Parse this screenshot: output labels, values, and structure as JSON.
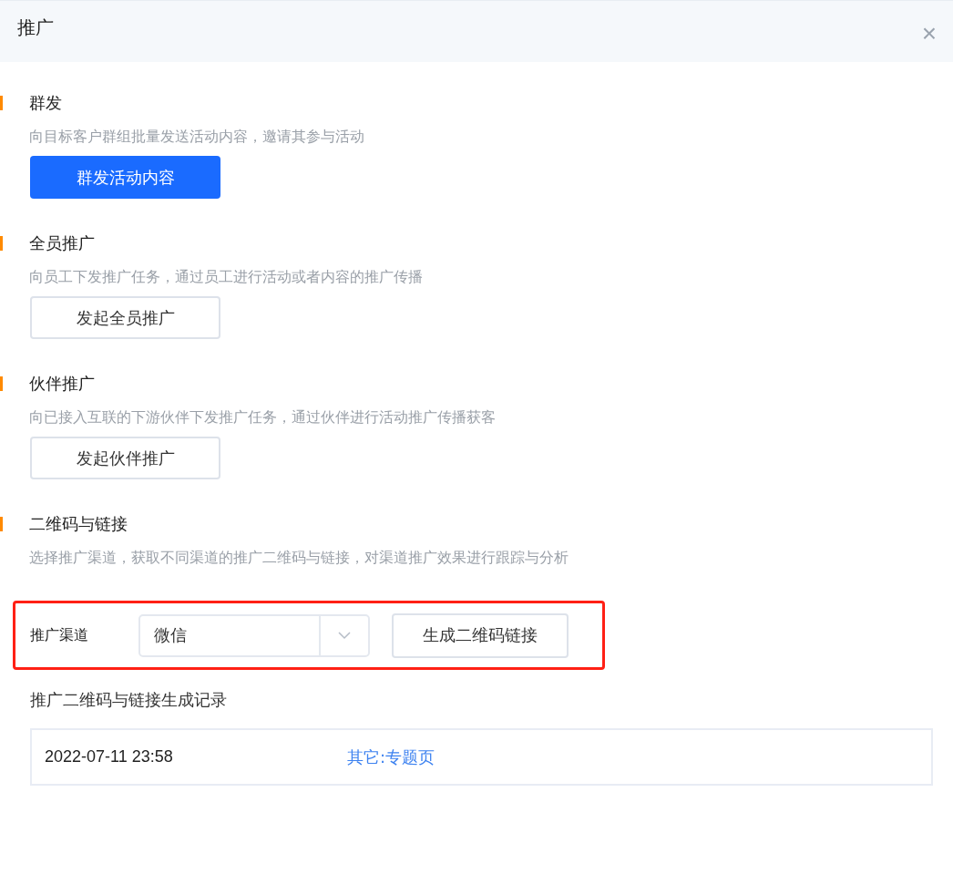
{
  "dialog": {
    "title": "推广",
    "close_label": "×"
  },
  "sections": [
    {
      "title": "群发",
      "description": "向目标客户群组批量发送活动内容，邀请其参与活动",
      "button": {
        "label": "群发活动内容",
        "kind": "primary"
      }
    },
    {
      "title": "全员推广",
      "description": "向员工下发推广任务，通过员工进行活动或者内容的推广传播",
      "button": {
        "label": "发起全员推广",
        "kind": "default"
      }
    },
    {
      "title": "伙伴推广",
      "description": "向已接入互联的下游伙伴下发推广任务，通过伙伴进行活动推广传播获客",
      "button": {
        "label": "发起伙伴推广",
        "kind": "default"
      }
    },
    {
      "title": "二维码与链接",
      "description": "选择推广渠道，获取不同渠道的推广二维码与链接，对渠道推广效果进行跟踪与分析"
    }
  ],
  "channel_form": {
    "highlighted": true,
    "label": "推广渠道",
    "select_value": "微信",
    "button": "生成二维码链接"
  },
  "records": {
    "title": "推广二维码与链接生成记录",
    "rows": [
      {
        "time": "2022-07-11 23:58",
        "channel": "其它:专题页"
      }
    ]
  }
}
